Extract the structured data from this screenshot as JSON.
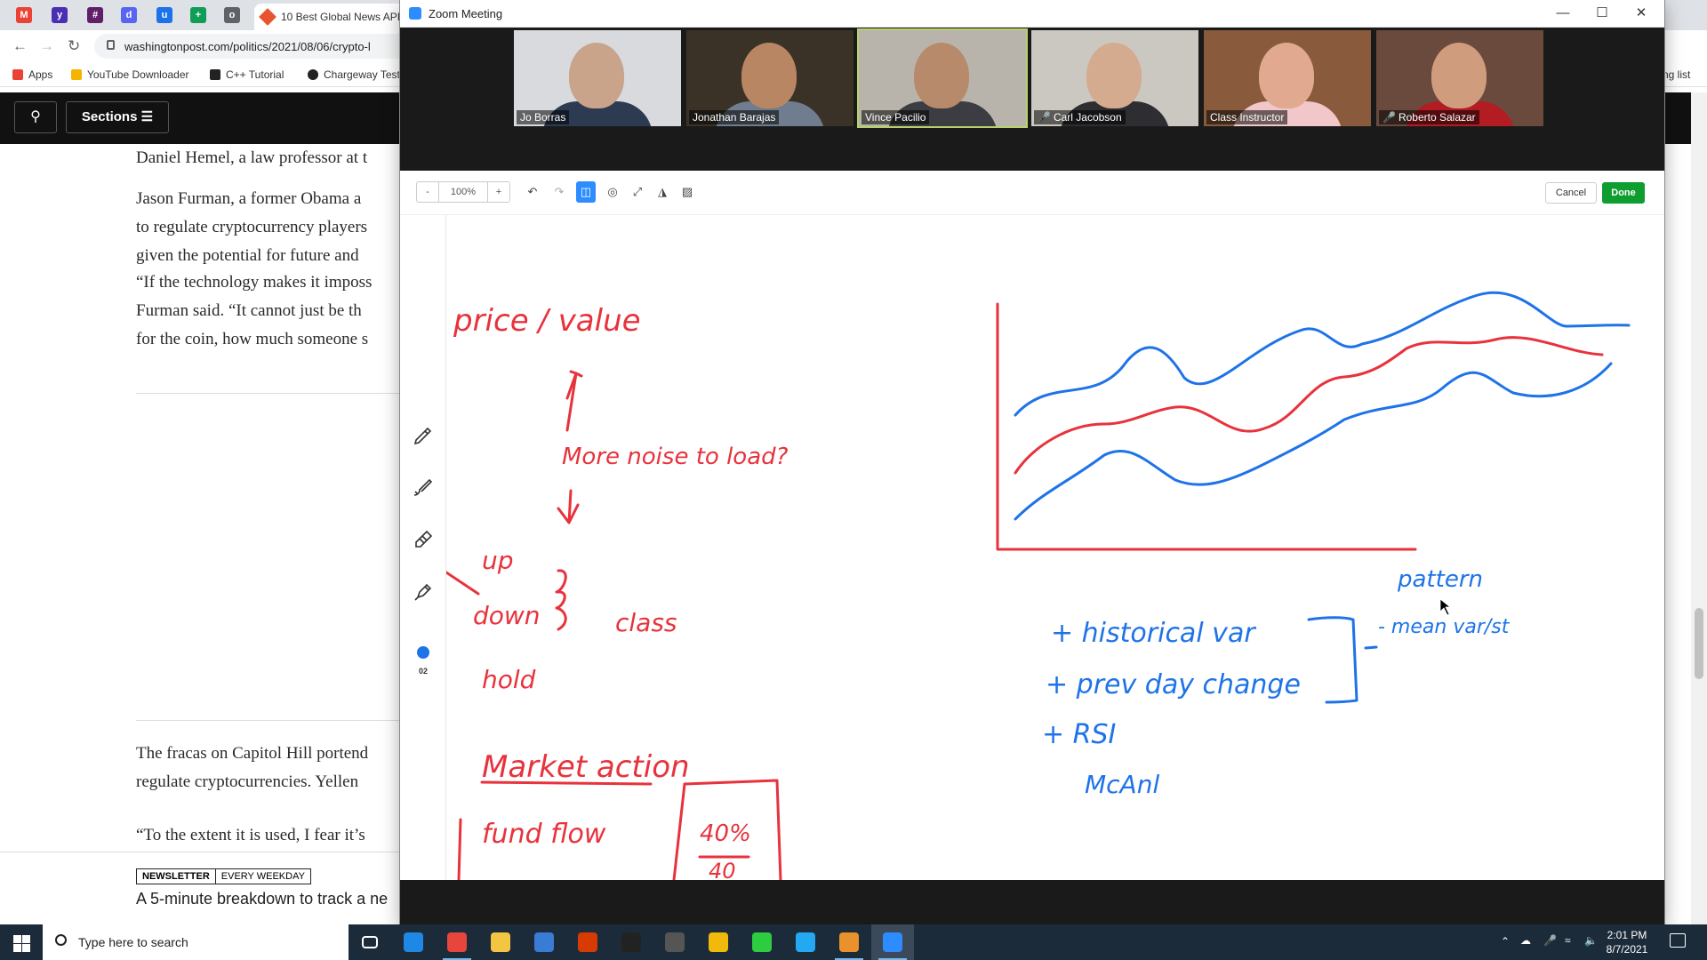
{
  "browser": {
    "active_tab_title": "10 Best Global News API",
    "url": "washingtonpost.com/politics/2021/08/06/crypto-l",
    "bookmarks": [
      {
        "label": "Apps",
        "color": "#ea4335"
      },
      {
        "label": "YouTube Downloader",
        "color": "#f4b400"
      },
      {
        "label": "C++ Tutorial",
        "color": "#222222"
      },
      {
        "label": "Chargeway Test",
        "color": "#222222"
      }
    ],
    "reading_list": "ng list",
    "tab_icons": [
      {
        "name": "gmail-icon",
        "color": "#ea4335",
        "glyph": "M"
      },
      {
        "name": "yahoo-icon",
        "color": "#4a2fb5",
        "glyph": "y"
      },
      {
        "name": "slack-icon",
        "color": "#611f69",
        "glyph": "#"
      },
      {
        "name": "discord-icon",
        "color": "#5865f2",
        "glyph": "d"
      },
      {
        "name": "user-icon",
        "color": "#1a73e8",
        "glyph": "u"
      },
      {
        "name": "sheets-icon",
        "color": "#0f9d58",
        "glyph": "+"
      },
      {
        "name": "globe-icon",
        "color": "#5f6368",
        "glyph": "o"
      }
    ]
  },
  "washpost": {
    "search_icon": "search-icon",
    "sections_label": "Sections",
    "paragraphs": [
      {
        "lines": [
          "Daniel Hemel, a law professor at t"
        ]
      },
      {
        "lines": [
          "Jason Furman, a former Obama a",
          "to regulate cryptocurrency players",
          "given the potential for future and"
        ]
      },
      {
        "lines": [
          "“If the technology makes it imposs",
          "Furman said. “It cannot just be th",
          "for the coin, how much someone s"
        ]
      },
      {
        "lines": [
          "The fracas on Capitol Hill portend",
          "regulate cryptocurrencies. Yellen"
        ]
      },
      {
        "lines": [
          "“To the extent it is used, I fear it’s"
        ]
      }
    ],
    "newsletter_badge": "NEWSLETTER",
    "newsletter_freq": "EVERY WEEKDAY",
    "newsletter_text": "A 5-minute breakdown to track a ne"
  },
  "zoom": {
    "window_title": "Zoom Meeting",
    "participants": [
      {
        "name": "Jo Borras",
        "muted": false,
        "speaking": false,
        "bg": "#d8dade",
        "skin": "#c9a48a",
        "shirt": "#2d3b52"
      },
      {
        "name": "Jonathan Barajas",
        "muted": false,
        "speaking": false,
        "bg": "#3a3226",
        "skin": "#b98664",
        "shirt": "#6f7d8f"
      },
      {
        "name": "Vince Pacilio",
        "muted": false,
        "speaking": true,
        "bg": "#b9b4ab",
        "skin": "#b78a6c",
        "shirt": "#3b3d42"
      },
      {
        "name": "Carl Jacobson",
        "muted": true,
        "speaking": false,
        "bg": "#cbc7c1",
        "skin": "#d4ab8f",
        "shirt": "#2e2e32"
      },
      {
        "name": "Class Instructor",
        "muted": false,
        "speaking": false,
        "bg": "#8a5a3c",
        "skin": "#e0a990",
        "shirt": "#f2c7c9"
      },
      {
        "name": "Roberto Salazar",
        "muted": true,
        "speaking": false,
        "bg": "#6a4a3c",
        "skin": "#d09c7e",
        "shirt": "#b21c22"
      }
    ],
    "whiteboard": {
      "zoom_minus": "-",
      "zoom_level": "100%",
      "zoom_plus": "+",
      "cancel_label": "Cancel",
      "done_label": "Done",
      "pen_size": "02",
      "pen_color": "#1e73e8",
      "ink_red": "#e8323c",
      "ink_blue": "#1e73e8",
      "notes": {
        "price_value": "price / value",
        "noise": "More noise to load?",
        "up": "up",
        "down": "down",
        "hold": "hold",
        "class": "class",
        "market_action": "Market action",
        "fund_flow": "fund flow",
        "pct_top": "40%",
        "pct_bottom": "40",
        "historical": "+ historical var",
        "prev_day": "+ prev day change",
        "rsi": "+ RSI",
        "macd": "McAnl",
        "pattern": "pattern",
        "mean_var": "- mean var/st"
      }
    }
  },
  "taskbar": {
    "search_placeholder": "Type here to search",
    "time": "2:01 PM",
    "date": "8/7/2021",
    "apps": [
      {
        "name": "task-view-icon",
        "color": "#ffffff",
        "open": false
      },
      {
        "name": "edge-icon",
        "color": "#1e88e5",
        "open": false
      },
      {
        "name": "chrome-icon",
        "color": "#e8453c",
        "open": true
      },
      {
        "name": "file-explorer-icon",
        "color": "#f4c542",
        "open": false
      },
      {
        "name": "calculator-icon",
        "color": "#3a7bd5",
        "open": false
      },
      {
        "name": "office-icon",
        "color": "#d83b01",
        "open": false
      },
      {
        "name": "terminal-icon",
        "color": "#222222",
        "open": false
      },
      {
        "name": "terminal2-icon",
        "color": "#555555",
        "open": false
      },
      {
        "name": "git-icon",
        "color": "#f0b90b",
        "open": false
      },
      {
        "name": "circle-app-icon",
        "color": "#2ecc40",
        "open": false
      },
      {
        "name": "vscode-icon",
        "color": "#23a9f2",
        "open": false
      },
      {
        "name": "slack-icon",
        "color": "#e8912d",
        "open": true
      },
      {
        "name": "zoom-icon",
        "color": "#2d8cff",
        "open": true
      }
    ]
  }
}
